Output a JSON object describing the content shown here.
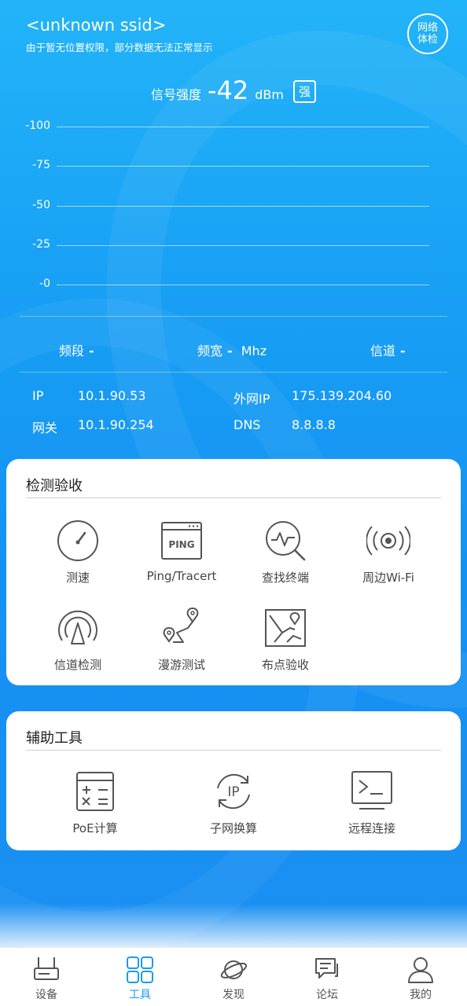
{
  "header": {
    "ssid": "<unknown ssid>",
    "permission_note": "由于暂无位置权限，部分数据无法正常显示",
    "check_button": [
      "网络",
      "体检"
    ]
  },
  "signal": {
    "label": "信号强度",
    "value": "-42",
    "unit": "dBm",
    "badge": "强"
  },
  "chart_data": {
    "type": "line",
    "ylim": [
      -100,
      0
    ],
    "y_ticks": [
      "-100",
      "-75",
      "-50",
      "-25",
      "-0"
    ],
    "grid": true,
    "series": []
  },
  "band_info": {
    "band_label": "频段",
    "band_value": "-",
    "width_label": "频宽",
    "width_value": "-",
    "width_unit": "Mhz",
    "channel_label": "信道",
    "channel_value": "-"
  },
  "network": {
    "ip_label": "IP",
    "ip_value": "10.1.90.53",
    "wan_label": "外网IP",
    "wan_value": "175.139.204.60",
    "gateway_label": "网关",
    "gateway_value": "10.1.90.254",
    "dns_label": "DNS",
    "dns_value": "8.8.8.8"
  },
  "detect_card": {
    "title": "检测验收",
    "tools": [
      {
        "label": "测速",
        "icon": "speedometer-icon"
      },
      {
        "label": "Ping/Tracert",
        "icon": "ping-icon"
      },
      {
        "label": "查找终端",
        "icon": "find-terminal-icon"
      },
      {
        "label": "周边Wi-Fi",
        "icon": "wifi-broadcast-icon"
      },
      {
        "label": "信道检测",
        "icon": "channel-detect-icon"
      },
      {
        "label": "漫游测试",
        "icon": "roaming-route-icon"
      },
      {
        "label": "布点验收",
        "icon": "map-point-icon"
      }
    ],
    "ping_text": "PING"
  },
  "aux_card": {
    "title": "辅助工具",
    "tools": [
      {
        "label": "PoE计算",
        "icon": "calculator-icon"
      },
      {
        "label": "子网换算",
        "icon": "ip-convert-icon",
        "icon_text": "IP"
      },
      {
        "label": "远程连接",
        "icon": "terminal-icon"
      }
    ]
  },
  "tabbar": {
    "active": "工具",
    "items": [
      {
        "label": "设备",
        "icon": "router-icon"
      },
      {
        "label": "工具",
        "icon": "grid-icon"
      },
      {
        "label": "发现",
        "icon": "planet-icon"
      },
      {
        "label": "论坛",
        "icon": "chat-icon"
      },
      {
        "label": "我的",
        "icon": "user-icon"
      }
    ]
  },
  "colors": {
    "accent": "#1a9bf2",
    "icon_gray": "#555555"
  }
}
